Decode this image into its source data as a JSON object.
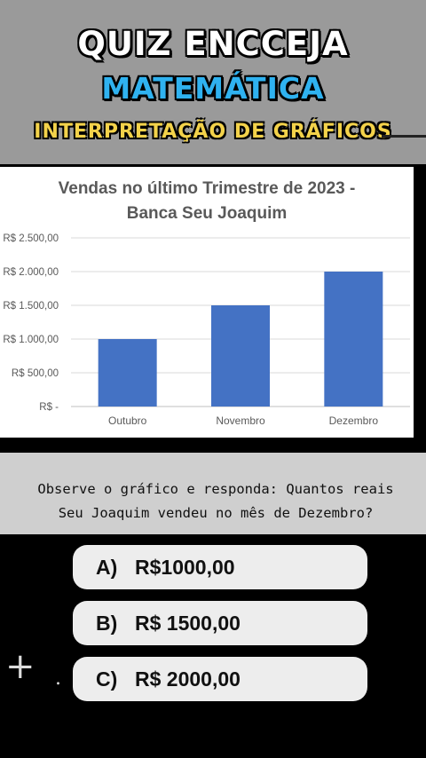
{
  "header": {
    "line1": "QUIZ ENCCEJA",
    "line2": "MATEMÁTICA",
    "line3": "INTERPRETAÇÃO DE GRÁFICOS"
  },
  "chart_data": {
    "type": "bar",
    "title": "Vendas no último Trimestre de 2023 - Banca Seu Joaquim",
    "title_lines": [
      "Vendas no último Trimestre de 2023 -",
      "Banca Seu Joaquim"
    ],
    "categories": [
      "Outubro",
      "Novembro",
      "Dezembro"
    ],
    "values": [
      1000,
      1500,
      2000
    ],
    "ylim": [
      0,
      2500
    ],
    "yticks": [
      0,
      500,
      1000,
      1500,
      2000,
      2500
    ],
    "ytick_labels": [
      "R$ -",
      "R$ 500,00",
      "R$ 1.000,00",
      "R$ 1.500,00",
      "R$ 2.000,00",
      "R$ 2.500,00"
    ],
    "xlabel": "",
    "ylabel": "",
    "grid": true,
    "bar_color": "#4472c4"
  },
  "question": {
    "line1": "Observe o gráfico e responda: Quantos reais",
    "line2": "Seu Joaquim vendeu no mês de Dezembro?"
  },
  "options": [
    {
      "letter": "A)",
      "text": "R$1000,00"
    },
    {
      "letter": "B)",
      "text": "R$ 1500,00"
    },
    {
      "letter": "C)",
      "text": "R$ 2000,00"
    }
  ]
}
